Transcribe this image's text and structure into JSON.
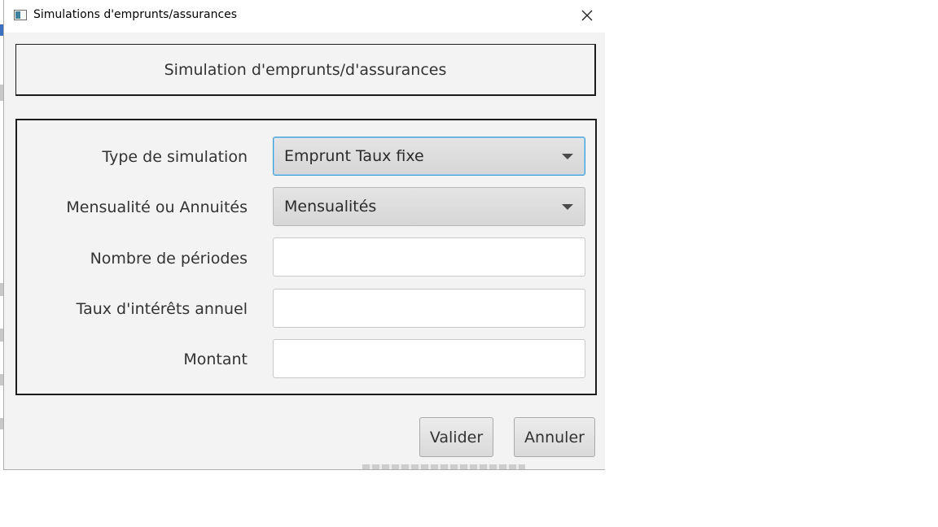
{
  "window": {
    "title": "Simulations d'emprunts/assurances"
  },
  "header": {
    "title": "Simulation d'emprunts/d'assurances"
  },
  "form": {
    "simulation_type": {
      "label": "Type de simulation",
      "value": "Emprunt Taux fixe"
    },
    "payment_mode": {
      "label": "Mensualité ou Annuités",
      "value": "Mensualités"
    },
    "periods": {
      "label": "Nombre de périodes",
      "value": ""
    },
    "interest_rate": {
      "label": "Taux d'intérêts annuel",
      "value": ""
    },
    "amount": {
      "label": "Montant",
      "value": ""
    }
  },
  "buttons": {
    "validate": "Valider",
    "cancel": "Annuler"
  },
  "icons": {
    "app": "window-icon",
    "close": "close-icon",
    "dropdown": "chevron-down-icon"
  },
  "colors": {
    "focus_border": "#3d9ad3",
    "window_bg": "#f3f3f3",
    "frame_border": "#1d1d1d"
  }
}
